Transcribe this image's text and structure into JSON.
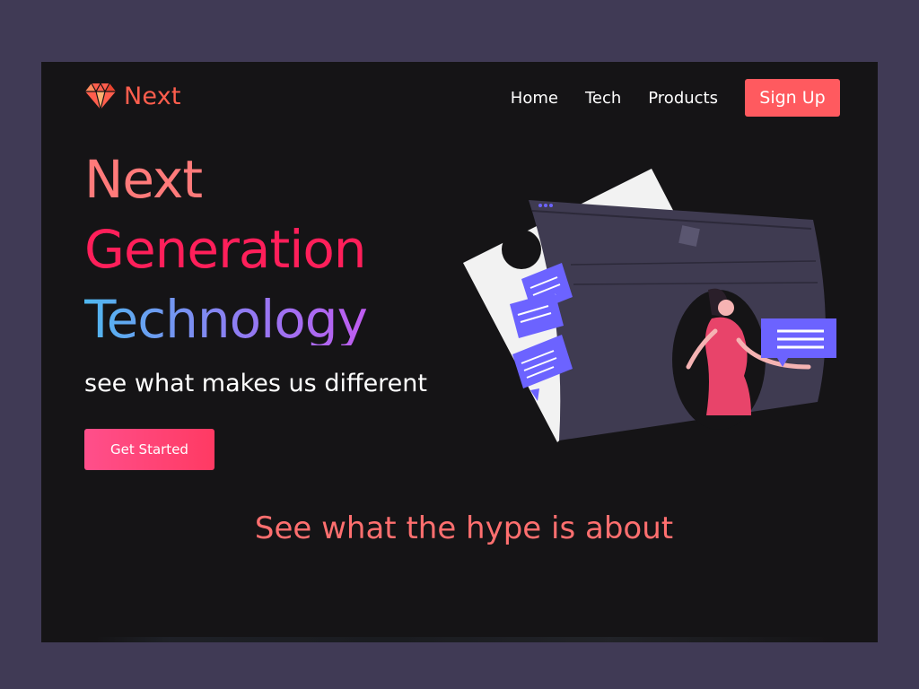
{
  "brand": {
    "name": "Next",
    "icon": "diamond-icon",
    "color": "#ff5e4d"
  },
  "nav": {
    "items": [
      {
        "label": "Home"
      },
      {
        "label": "Tech"
      },
      {
        "label": "Products"
      }
    ],
    "signup_label": "Sign Up"
  },
  "hero": {
    "line1": "Next",
    "line2": "Generation",
    "line3": "Technology",
    "tagline": "see what makes us different",
    "cta_label": "Get Started"
  },
  "section": {
    "title": "See what the hype is about"
  },
  "colors": {
    "background": "#403a55",
    "surface": "#151416",
    "accent": "#ff5a5f",
    "hero_pink": "#ff1f5a",
    "chat_purple": "#6c63ff"
  }
}
